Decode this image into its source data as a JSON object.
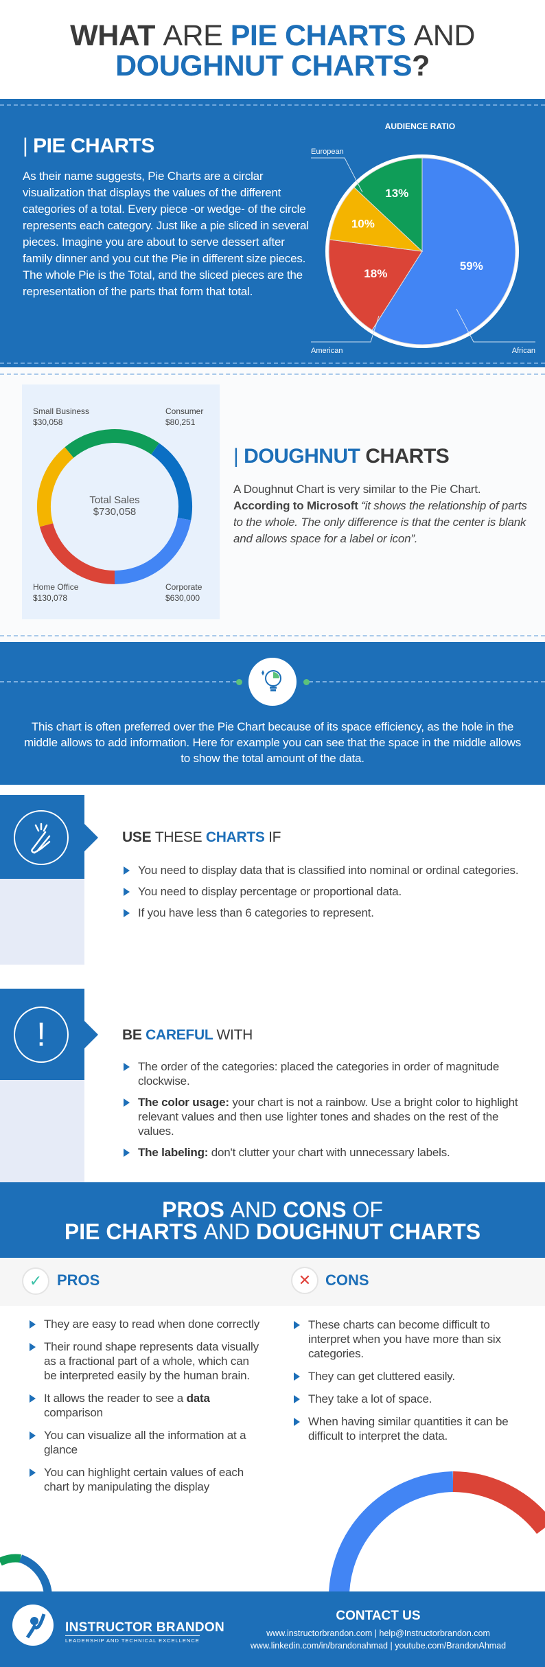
{
  "title": {
    "w1": "WHAT",
    "w2": "ARE",
    "w3": "PIE CHARTS",
    "w4": "AND",
    "w5": "DOUGHNUT CHARTS",
    "w6": "?"
  },
  "pie_section": {
    "heading": "PIE CHARTS",
    "body": "As their name suggests, Pie Charts are a circlar visualization that displays the values of the different categories of a total. Every piece -or wedge- of the circle represents each category. Just like a pie sliced in several pieces. Imagine you are about to serve dessert after family dinner and you cut the Pie in different size pieces. The whole Pie is the Total, and the sliced pieces are the representation of the parts that form that total."
  },
  "doughnut_section": {
    "heading_a": "DOUGHNUT",
    "heading_b": "CHARTS",
    "body_plain": "A Doughnut Chart is very similar to the Pie Chart.",
    "body_bold": "According to Microsoft",
    "body_quote": "“it shows the relationship of parts to the whole. The only difference is that the center is blank and allows space for a label or icon”."
  },
  "chart_data": [
    {
      "type": "pie",
      "title": "AUDIENCE RATIO",
      "categories": [
        "African",
        "American",
        "",
        "European"
      ],
      "values": [
        59,
        18,
        10,
        13
      ],
      "value_labels": [
        "59%",
        "18%",
        "10%",
        "13%"
      ],
      "colors": [
        "#4285f4",
        "#db4437",
        "#f4b400",
        "#0f9d58"
      ],
      "start": "top",
      "direction": "clockwise"
    },
    {
      "type": "doughnut",
      "center_label": "Total Sales",
      "center_value": "$730,058",
      "categories": [
        "Small Business",
        "Consumer",
        "Corporate",
        "Home Office"
      ],
      "value_labels": [
        "$30,058",
        "$80,251",
        "$630,000",
        "$130,078"
      ],
      "values": [
        30058,
        80251,
        630000,
        130078
      ],
      "segment_colors": [
        "#0f9d58",
        "#0b6fc4",
        "#4285f4",
        "#db4437",
        "#f4b400"
      ]
    }
  ],
  "info_band": {
    "icon": "lightbulb-pie-icon",
    "text": "This chart is often preferred over the Pie Chart because of its space efficiency, as the hole in the middle allows to add information. Here for example you can see that the space in the middle allows to show the total amount of the data."
  },
  "use": {
    "icon": "crossed-fingers-icon",
    "h_a": "USE",
    "h_b": "THESE",
    "h_c": "CHARTS",
    "h_d": "IF",
    "items": [
      "You need to display data that is classified into nominal or ordinal categories.",
      "You need to display percentage or proportional data.",
      "If you have less than 6 categories to represent."
    ]
  },
  "careful": {
    "icon": "exclamation-icon",
    "h_a": "BE",
    "h_b": "CAREFUL",
    "h_c": "WITH",
    "items": [
      {
        "bold": "",
        "text": "The order of the categories: placed the categories in order of magnitude clockwise."
      },
      {
        "bold": "The color usage:",
        "text": " your chart is not a rainbow. Use a bright color to highlight relevant values and then use lighter tones and shades on the rest of the values."
      },
      {
        "bold": "The labeling:",
        "text": " don't clutter your chart with unnecessary labels."
      }
    ]
  },
  "proscons": {
    "h1_a": "PROS",
    "h1_b": "AND",
    "h1_c": "CONS",
    "h1_d": "OF",
    "h2_a": "PIE CHARTS",
    "h2_b": "AND",
    "h2_c": "DOUGHNUT CHARTS",
    "pros_label": "PROS",
    "cons_label": "CONS",
    "pros": [
      {
        "text": "They are easy to read when done correctly",
        "bold": ""
      },
      {
        "text": "Their round shape represents data visually as a fractional part of a whole, which can be interpreted easily by the human brain.",
        "bold": ""
      },
      {
        "text": "It allows the reader to see a ",
        "bold": "data",
        "after": " comparison"
      },
      {
        "text": "You can visualize all the information at a glance",
        "bold": ""
      },
      {
        "text": "You can highlight certain values of each chart by manipulating the display",
        "bold": ""
      }
    ],
    "cons": [
      "These charts can become difficult to interpret when you have more than six categories.",
      "They can get cluttered easily.",
      "They take a lot of space.",
      "When having similar quantities it can be difficult to interpret the data."
    ]
  },
  "footer": {
    "brand": "INSTRUCTOR BRANDON",
    "tagline": "LEADERSHIP AND TECHNICAL EXCELLENCE",
    "contact_title": "CONTACT US",
    "line1": "www.instructorbrandon.com | help@Instructorbrandon.com",
    "line2": "www.linkedin.com/in/brandonahmad | youtube.com/BrandonAhmad"
  },
  "colors": {
    "brand_blue": "#1d6fb8"
  }
}
